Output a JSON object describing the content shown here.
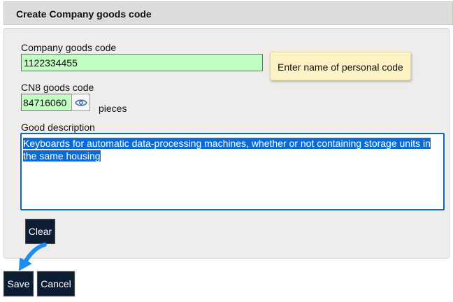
{
  "header": {
    "title": "Create Company goods code"
  },
  "form": {
    "company_code_label": "Company goods code",
    "company_code_value": "1122334455",
    "tooltip": "Enter name of personal code",
    "cn8_label": "CN8 goods code",
    "cn8_value": "84716060",
    "unit": "pieces",
    "description_label": "Good description",
    "description_value": "Keyboards for automatic data-processing machines, whether or not containing storage units in the same housing"
  },
  "buttons": {
    "clear": "Clear",
    "save": "Save",
    "cancel": "Cancel"
  },
  "icons": {
    "view": "eye-icon",
    "pointer": "arrow-pointer-icon"
  },
  "colors": {
    "input_valid_bg": "#c2fec2",
    "selection": "#0a6bd6",
    "focus_border": "#0b63c8",
    "button_bg": "#0c1c33",
    "tooltip_bg": "#fdf2c3",
    "arrow": "#1e8ff0"
  }
}
